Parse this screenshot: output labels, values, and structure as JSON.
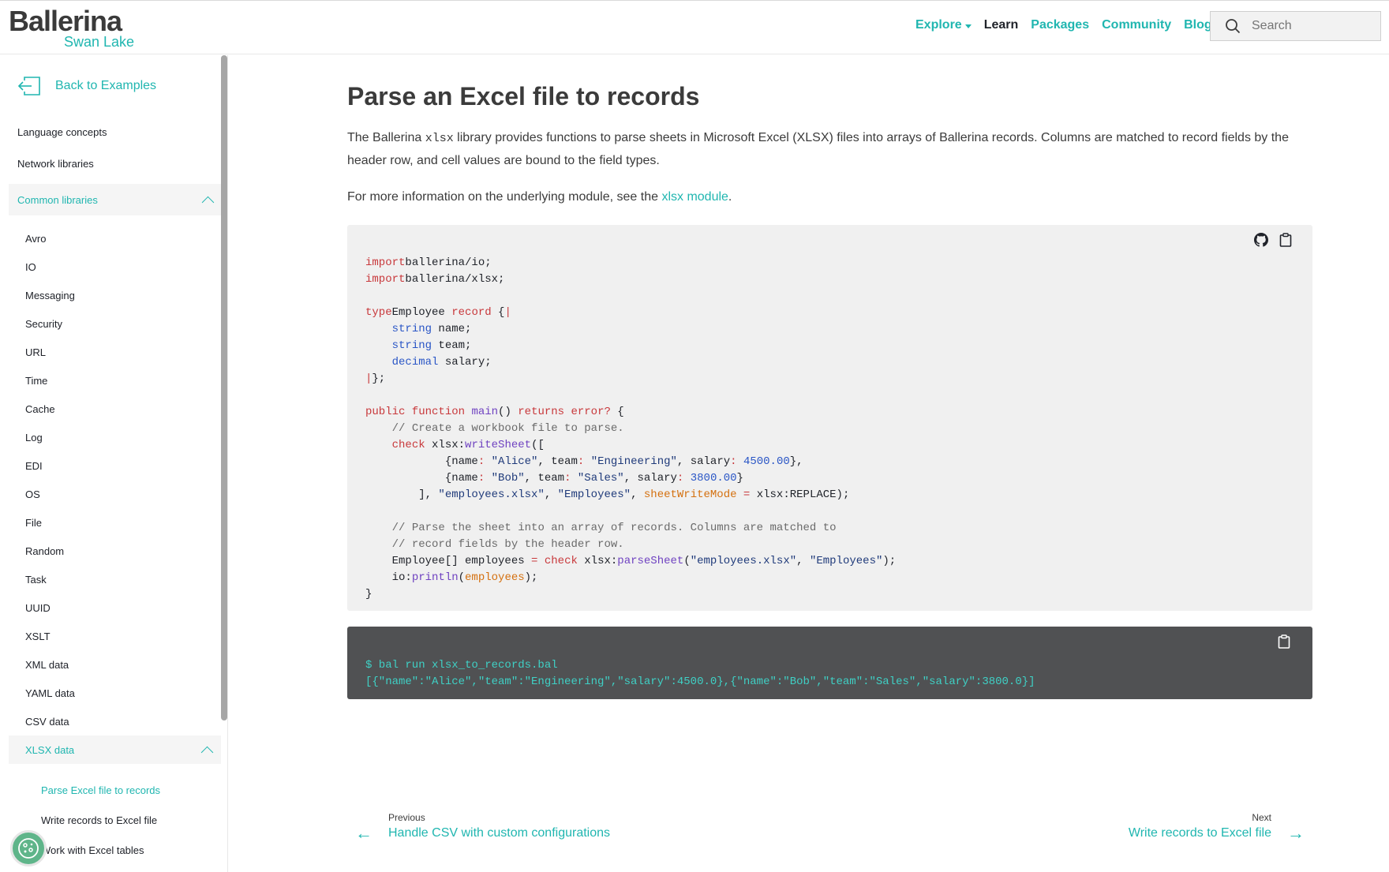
{
  "header": {
    "logo_main": "Ballerina",
    "logo_sub": "Swan Lake",
    "nav": [
      {
        "label": "Explore",
        "has_dropdown": true,
        "active": false
      },
      {
        "label": "Learn",
        "active": true
      },
      {
        "label": "Packages",
        "active": false
      },
      {
        "label": "Community",
        "active": false
      },
      {
        "label": "Blog",
        "active": false
      }
    ],
    "search_placeholder": "Search"
  },
  "sidebar": {
    "back_label": "Back to Examples",
    "sections": [
      "Language concepts",
      "Network libraries"
    ],
    "common_libraries": "Common libraries",
    "libraries": [
      "Avro",
      "IO",
      "Messaging",
      "Security",
      "URL",
      "Time",
      "Cache",
      "Log",
      "EDI",
      "OS",
      "File",
      "Random",
      "Task",
      "UUID",
      "XSLT",
      "XML data",
      "YAML data",
      "CSV data"
    ],
    "xlsx_group": "XLSX data",
    "xlsx_items": [
      "Parse Excel file to records",
      "Write records to Excel file",
      "Work with Excel tables"
    ],
    "active_item": "Parse Excel file to records"
  },
  "page": {
    "title": "Parse an Excel file to records",
    "intro_1": "The Ballerina ",
    "intro_code": "xlsx",
    "intro_2": " library provides functions to parse sheets in Microsoft Excel (XLSX) files into arrays of Ballerina records. Columns are matched to record fields by the header row, and cell values are bound to the field types.",
    "more_info_prefix": "For more information on the underlying module, see the ",
    "more_info_link": "xlsx module",
    "more_info_suffix": ".",
    "output_command": "$ bal run xlsx_to_records.bal",
    "output_result": "[{\"name\":\"Alice\",\"team\":\"Engineering\",\"salary\":4500.0},{\"name\":\"Bob\",\"team\":\"Sales\",\"salary\":3800.0}]",
    "previous_label": "Previous",
    "previous_title": "Handle CSV with custom configurations",
    "next_label": "Next",
    "next_title": "Write records to Excel file"
  },
  "code_lines": [
    [
      [
        "kw",
        "import"
      ],
      [
        "",
        "ballerina/io;"
      ]
    ],
    [
      [
        "kw",
        "import"
      ],
      [
        "",
        "ballerina/xlsx;"
      ]
    ],
    [],
    [
      [
        "kw",
        "type"
      ],
      [
        "",
        "Employee",
        " "
      ],
      [
        "kw",
        "record"
      ],
      [
        "",
        " {"
      ],
      [
        "kw",
        "|"
      ]
    ],
    [
      [
        "",
        "    "
      ],
      [
        "ty",
        "string"
      ],
      [
        "",
        " name;"
      ]
    ],
    [
      [
        "",
        "    "
      ],
      [
        "ty",
        "string"
      ],
      [
        "",
        " team;"
      ]
    ],
    [
      [
        "",
        "    "
      ],
      [
        "ty",
        "decimal"
      ],
      [
        "",
        " salary;"
      ]
    ],
    [
      [
        "kw",
        "|"
      ],
      [
        "",
        "};"
      ]
    ],
    [],
    [
      [
        "kw",
        "public function"
      ],
      [
        "",
        " "
      ],
      [
        "fn",
        "main"
      ],
      [
        "",
        "() "
      ],
      [
        "kw",
        "returns error?"
      ],
      [
        "",
        " {"
      ]
    ],
    [
      [
        "",
        "    "
      ],
      [
        "cm",
        "// Create a workbook file to parse."
      ]
    ],
    [
      [
        "",
        "    "
      ],
      [
        "kw",
        "check"
      ],
      [
        "",
        " xlsx:"
      ],
      [
        "fn",
        "writeSheet"
      ],
      [
        "",
        "(["
      ]
    ],
    [
      [
        "",
        "            {name"
      ],
      [
        "kw",
        ":"
      ],
      [
        "",
        " "
      ],
      [
        "str",
        "\"Alice\""
      ],
      [
        "",
        ", team"
      ],
      [
        "kw",
        ":"
      ],
      [
        "",
        " "
      ],
      [
        "str",
        "\"Engineering\""
      ],
      [
        "",
        ", salary"
      ],
      [
        "kw",
        ":"
      ],
      [
        "",
        " "
      ],
      [
        "num",
        "4500.00"
      ],
      [
        "",
        "},"
      ]
    ],
    [
      [
        "",
        "            {name"
      ],
      [
        "kw",
        ":"
      ],
      [
        "",
        " "
      ],
      [
        "str",
        "\"Bob\""
      ],
      [
        "",
        ", team"
      ],
      [
        "kw",
        ":"
      ],
      [
        "",
        " "
      ],
      [
        "str",
        "\"Sales\""
      ],
      [
        "",
        ", salary"
      ],
      [
        "kw",
        ":"
      ],
      [
        "",
        " "
      ],
      [
        "num",
        "3800.00"
      ],
      [
        "",
        "}"
      ]
    ],
    [
      [
        "",
        "        ], "
      ],
      [
        "str",
        "\"employees.xlsx\""
      ],
      [
        "",
        ", "
      ],
      [
        "str",
        "\"Employees\""
      ],
      [
        "",
        ", "
      ],
      [
        "or",
        "sheetWriteMode"
      ],
      [
        "",
        " "
      ],
      [
        "kw",
        "="
      ],
      [
        "",
        " xlsx:REPLACE);"
      ]
    ],
    [],
    [
      [
        "",
        "    "
      ],
      [
        "cm",
        "// Parse the sheet into an array of records. Columns are matched to"
      ]
    ],
    [
      [
        "",
        "    "
      ],
      [
        "cm",
        "// record fields by the header row."
      ]
    ],
    [
      [
        "",
        "    Employee[] employees "
      ],
      [
        "kw",
        "="
      ],
      [
        "",
        " "
      ],
      [
        "kw",
        "check"
      ],
      [
        "",
        " xlsx:"
      ],
      [
        "fn",
        "parseSheet"
      ],
      [
        "",
        "("
      ],
      [
        "str",
        "\"employees.xlsx\""
      ],
      [
        "",
        ", "
      ],
      [
        "str",
        "\"Employees\""
      ],
      [
        "",
        ");"
      ]
    ],
    [
      [
        "",
        "    io:"
      ],
      [
        "fn",
        "println"
      ],
      [
        "",
        "("
      ],
      [
        "or",
        "employees"
      ],
      [
        "",
        ");"
      ]
    ],
    [
      [
        "",
        "}"
      ]
    ]
  ],
  "colors": {
    "accent": "#20b6b0",
    "keyword": "#c8383b",
    "type": "#2a56c6",
    "output_bg": "#505153",
    "code_bg": "#f0f0f0"
  }
}
